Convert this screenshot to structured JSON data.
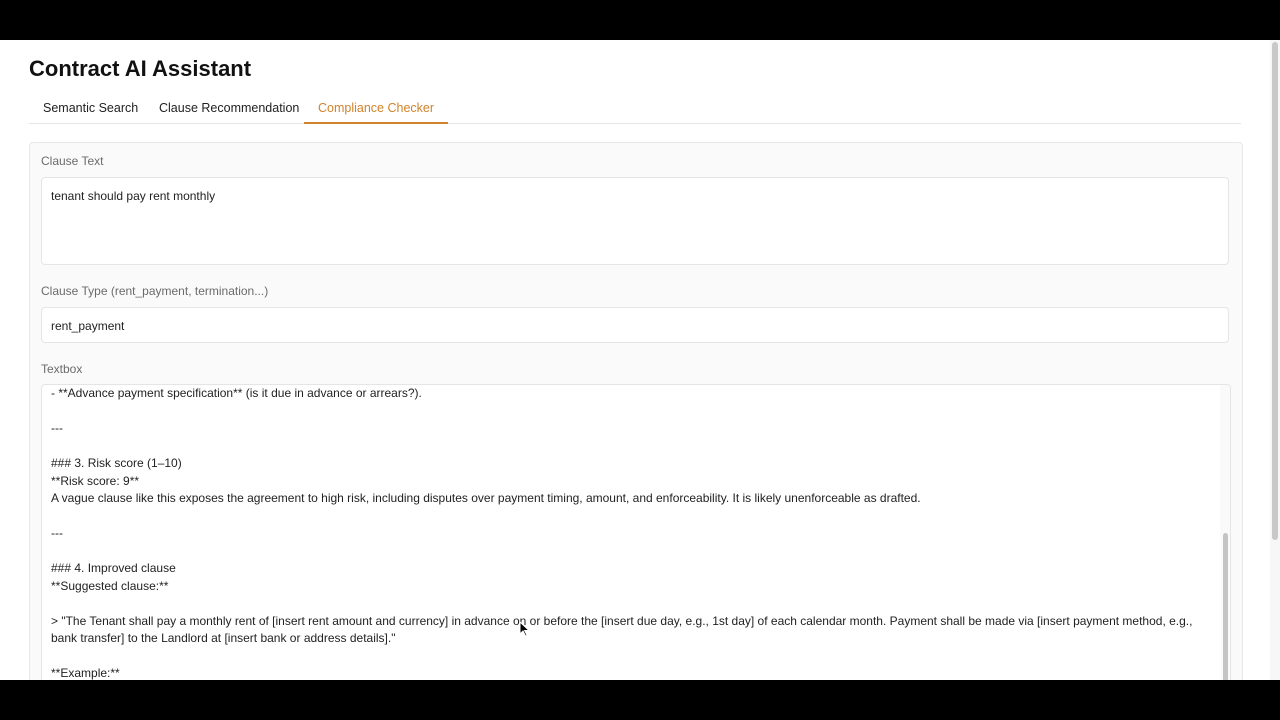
{
  "app": {
    "title": "Contract AI Assistant"
  },
  "tabs": [
    {
      "label": "Semantic Search",
      "active": false
    },
    {
      "label": "Clause Recommendation",
      "active": false
    },
    {
      "label": "Compliance Checker",
      "active": true
    }
  ],
  "accent_color": "#d1832a",
  "form": {
    "clause_text": {
      "label": "Clause Text",
      "value": "tenant should pay rent monthly"
    },
    "clause_type": {
      "label": "Clause Type (rent_payment, termination...)",
      "value": "rent_payment"
    },
    "output": {
      "label": "Textbox",
      "lines": [
        "- **Advance payment specification** (is it due in advance or arrears?).",
        "",
        "---",
        "",
        "### 3. Risk score (1–10)",
        "**Risk score: 9**",
        "A vague clause like this exposes the agreement to high risk, including disputes over payment timing, amount, and enforceability. It is likely unenforceable as drafted.",
        "",
        "---",
        "",
        "### 4. Improved clause",
        "**Suggested clause:**",
        "",
        "> \"The Tenant shall pay a monthly rent of [insert rent amount and currency] in advance on or before the [insert due day, e.g., 1st day] of each calendar month. Payment shall be made via [insert payment method, e.g., bank transfer] to the Landlord at [insert bank or address details].\"",
        "",
        "**Example:**"
      ]
    }
  }
}
